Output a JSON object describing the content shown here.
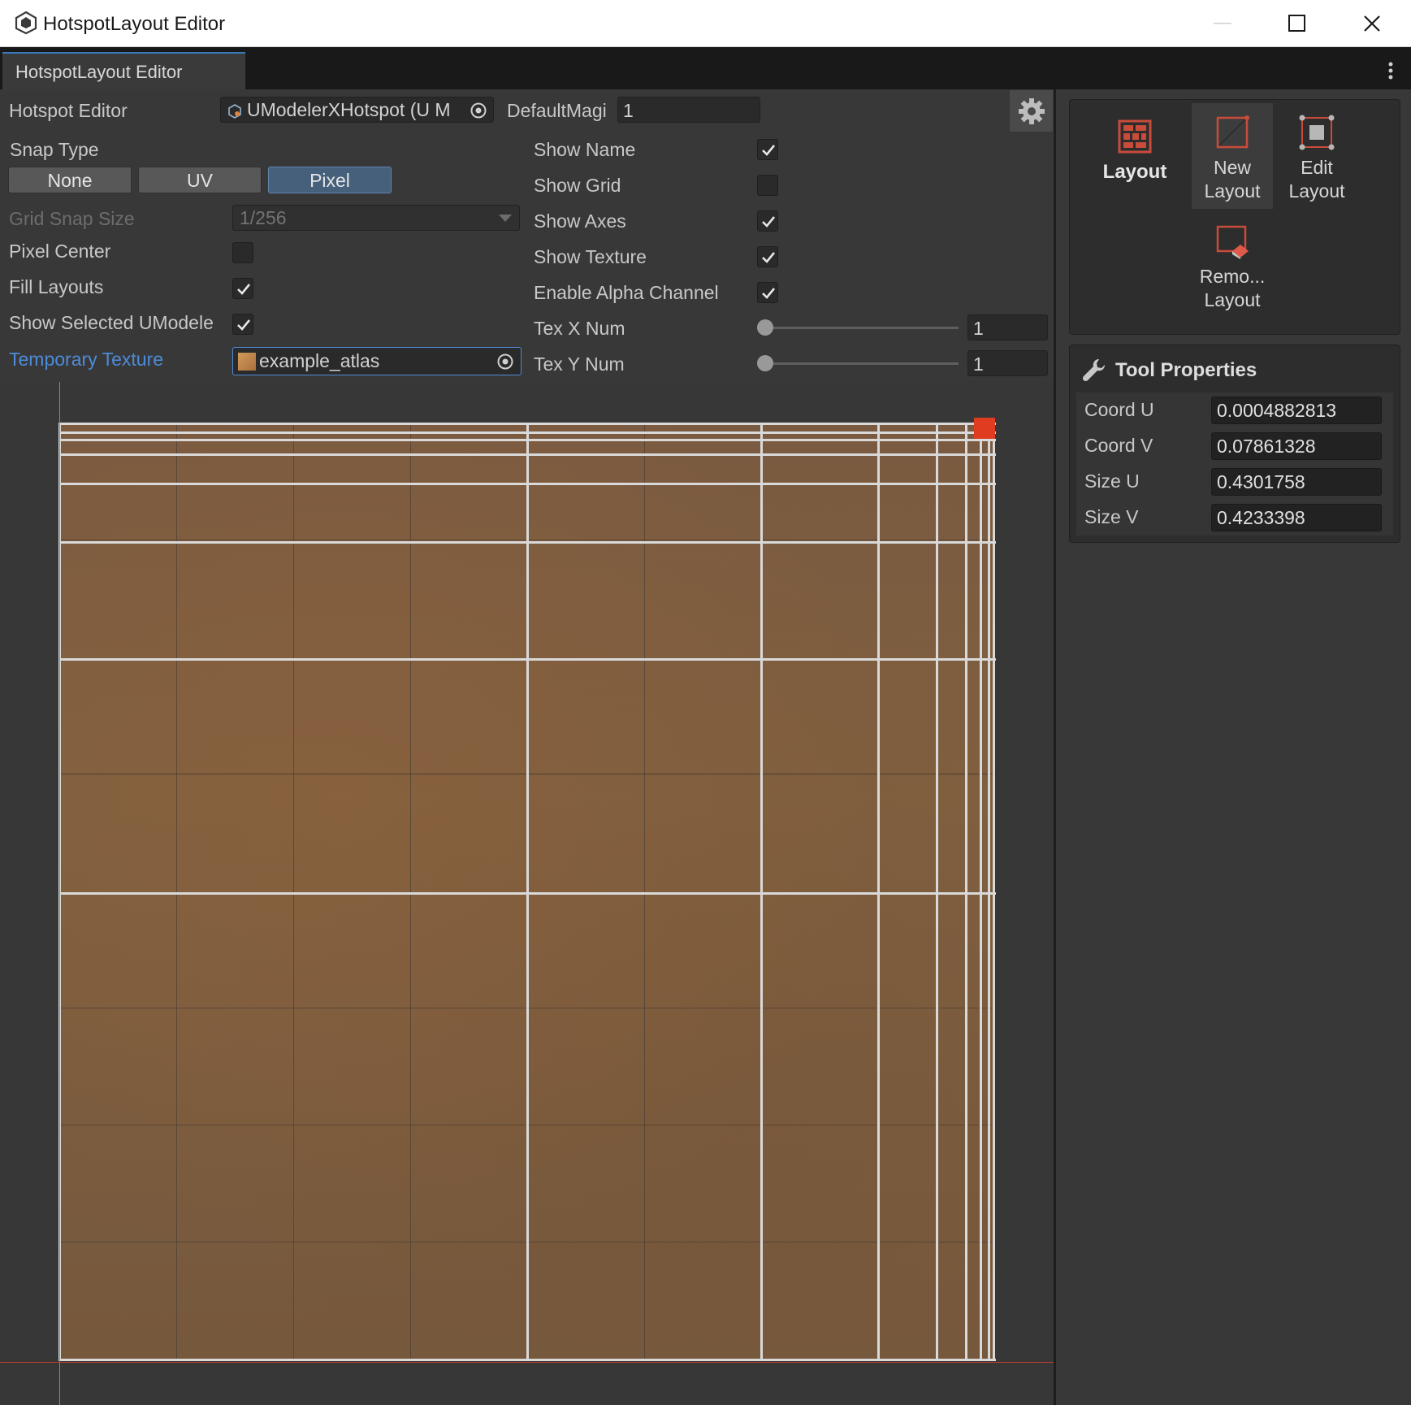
{
  "window": {
    "title": "HotspotLayout Editor"
  },
  "tab": {
    "label": "HotspotLayout Editor"
  },
  "editor": {
    "hotspot_editor_label": "Hotspot Editor",
    "hotspot_object": "UModelerXHotspot (U M",
    "default_mag_label": "DefaultMagi",
    "default_mag_value": "1",
    "snap_type_label": "Snap Type",
    "snap_options": [
      "None",
      "UV",
      "Pixel"
    ],
    "snap_selected": "Pixel",
    "grid_snap_size_label": "Grid Snap Size",
    "grid_snap_size_value": "1/256",
    "pixel_center_label": "Pixel Center",
    "pixel_center_checked": false,
    "fill_layouts_label": "Fill Layouts",
    "fill_layouts_checked": true,
    "show_selected_label": "Show Selected UModele",
    "show_selected_checked": true,
    "temporary_texture_label": "Temporary Texture",
    "temporary_texture_value": "example_atlas",
    "show_name_label": "Show Name",
    "show_name_checked": true,
    "show_grid_label": "Show Grid",
    "show_grid_checked": false,
    "show_axes_label": "Show Axes",
    "show_axes_checked": true,
    "show_texture_label": "Show Texture",
    "show_texture_checked": true,
    "enable_alpha_label": "Enable Alpha Channel",
    "enable_alpha_checked": true,
    "tex_x_num_label": "Tex X Num",
    "tex_x_num_value": "1",
    "tex_y_num_label": "Tex Y Num",
    "tex_y_num_value": "1",
    "accent_color": "#4d8bd8",
    "selection_color": "#e03c1f"
  },
  "tools": {
    "category_label": "Layout",
    "new_layout": {
      "line1": "New",
      "line2": "Layout"
    },
    "edit_layout": {
      "line1": "Edit",
      "line2": "Layout"
    },
    "remove_layout": {
      "line1": "Remo...",
      "line2": "Layout"
    }
  },
  "tool_properties": {
    "header": "Tool Properties",
    "rows": [
      {
        "label": "Coord U",
        "value": "0.0004882813"
      },
      {
        "label": "Coord V",
        "value": "0.07861328"
      },
      {
        "label": "Size U",
        "value": "0.4301758"
      },
      {
        "label": "Size V",
        "value": "0.4233398"
      }
    ]
  }
}
